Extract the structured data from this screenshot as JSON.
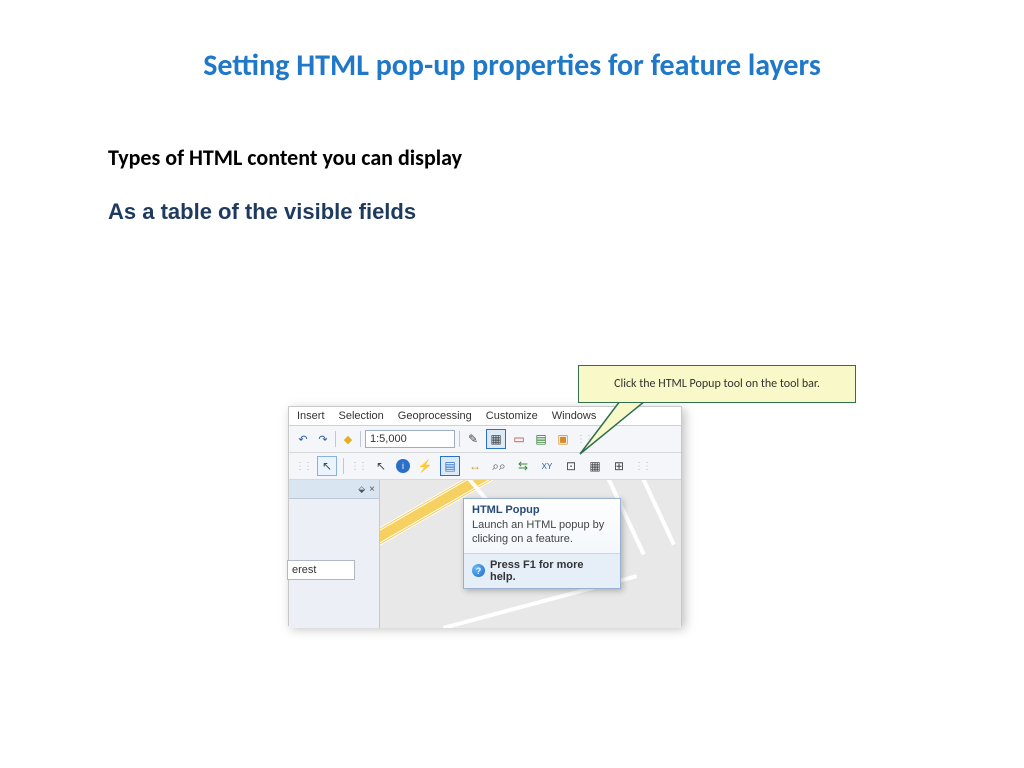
{
  "slide": {
    "title": "Setting HTML pop-up properties for feature layers",
    "subtitle": "Types of HTML content you can display",
    "section": "As a table of the visible fields"
  },
  "callout": {
    "text": "Click the HTML Popup tool on the tool bar."
  },
  "menubar": {
    "items": [
      "Insert",
      "Selection",
      "Geoprocessing",
      "Customize",
      "Windows"
    ]
  },
  "toolbar1": {
    "scale": "1:5,000"
  },
  "toolbar2": {
    "xy_label": "XY"
  },
  "sidebar": {
    "pin": "⇧",
    "close": "×",
    "item": "erest"
  },
  "tooltip": {
    "title": "HTML Popup",
    "body": "Launch an HTML popup by clicking on a feature.",
    "footer": "Press F1 for more help.",
    "help_icon": "?"
  }
}
